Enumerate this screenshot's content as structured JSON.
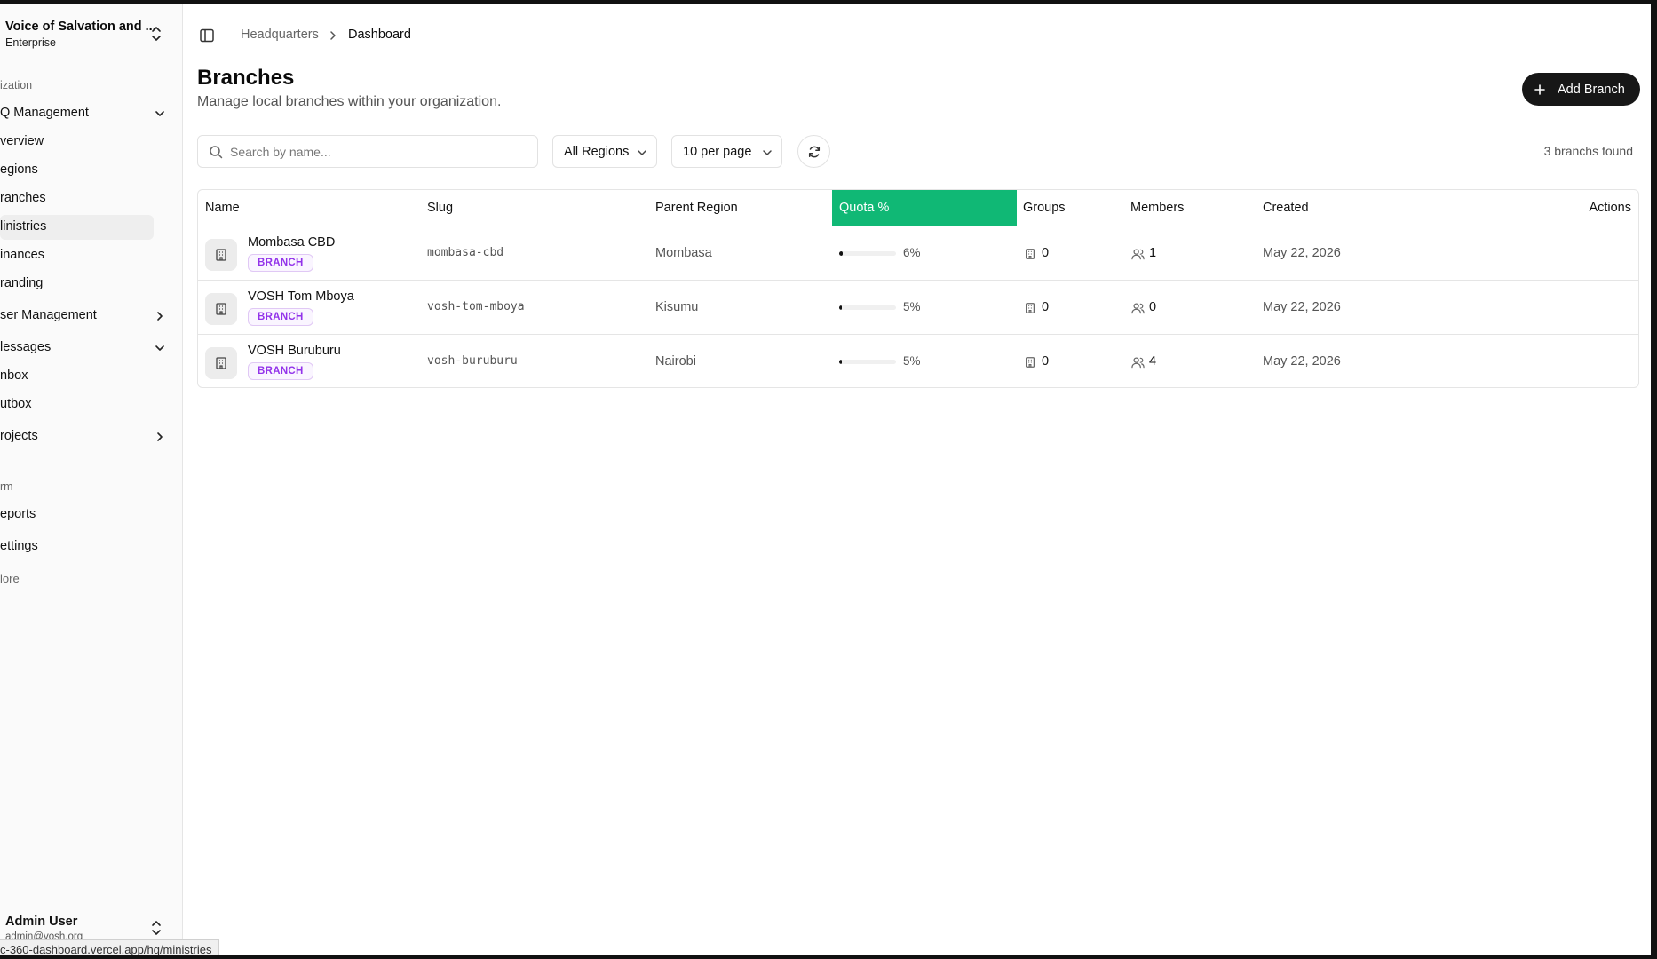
{
  "sidebar": {
    "org_name": "Voice of Salvation and ...",
    "org_plan": "Enterprise",
    "section_org": "ization",
    "items": [
      {
        "label": "Q Management"
      },
      {
        "label": "verview"
      },
      {
        "label": "egions"
      },
      {
        "label": "ranches"
      },
      {
        "label": "linistries"
      },
      {
        "label": "inances"
      },
      {
        "label": "randing"
      },
      {
        "label": "ser Management"
      },
      {
        "label": "lessages"
      },
      {
        "label": "nbox"
      },
      {
        "label": "utbox"
      },
      {
        "label": "rojects"
      }
    ],
    "section_platform": "rm",
    "platform_items": [
      {
        "label": "eports"
      },
      {
        "label": "ettings"
      },
      {
        "label": "lore"
      }
    ],
    "user_name": "Admin User",
    "user_email": "admin@vosh.org",
    "status_url": "c-360-dashboard.vercel.app/hq/ministries"
  },
  "breadcrumb": {
    "parent": "Headquarters",
    "current": "Dashboard"
  },
  "page": {
    "title": "Branches",
    "subtitle": "Manage local branches within your organization.",
    "add_button": "Add Branch",
    "search_placeholder": "Search by name...",
    "region_filter": "All Regions",
    "per_page": "10 per page",
    "found_text": "3 branchs found"
  },
  "table": {
    "headers": {
      "name": "Name",
      "slug": "Slug",
      "parent_region": "Parent Region",
      "quota": "Quota %",
      "groups": "Groups",
      "members": "Members",
      "created": "Created",
      "actions": "Actions"
    },
    "rows": [
      {
        "name": "Mombasa CBD",
        "badge": "BRANCH",
        "slug": "mombasa-cbd",
        "region": "Mombasa",
        "quota_pct": "6%",
        "quota": 6,
        "groups": "0",
        "members": "1",
        "created": "May 22, 2026"
      },
      {
        "name": "VOSH Tom Mboya",
        "badge": "BRANCH",
        "slug": "vosh-tom-mboya",
        "region": "Kisumu",
        "quota_pct": "5%",
        "quota": 5,
        "groups": "0",
        "members": "0",
        "created": "May 22, 2026"
      },
      {
        "name": "VOSH Buruburu",
        "badge": "BRANCH",
        "slug": "vosh-buruburu",
        "region": "Nairobi",
        "quota_pct": "5%",
        "quota": 5,
        "groups": "0",
        "members": "4",
        "created": "May 22, 2026"
      }
    ]
  },
  "colors": {
    "quota_header": "#10b875",
    "badge_text": "#9333ea",
    "primary_button": "#171717"
  }
}
